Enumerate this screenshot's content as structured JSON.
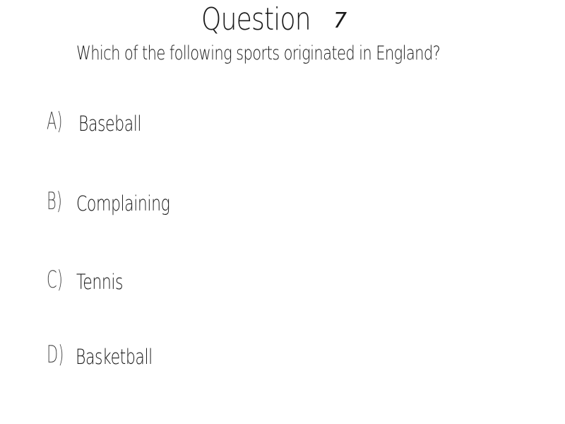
{
  "header": {
    "title_word": "Question",
    "title_number": "7"
  },
  "question": {
    "text": "Which of the following sports originated in England?"
  },
  "options": [
    {
      "letter": "A)",
      "text": "Baseball"
    },
    {
      "letter": "B)",
      "text": "Complaining"
    },
    {
      "letter": "C)",
      "text": "Tennis"
    },
    {
      "letter": "D)",
      "text": "Basketball"
    }
  ]
}
